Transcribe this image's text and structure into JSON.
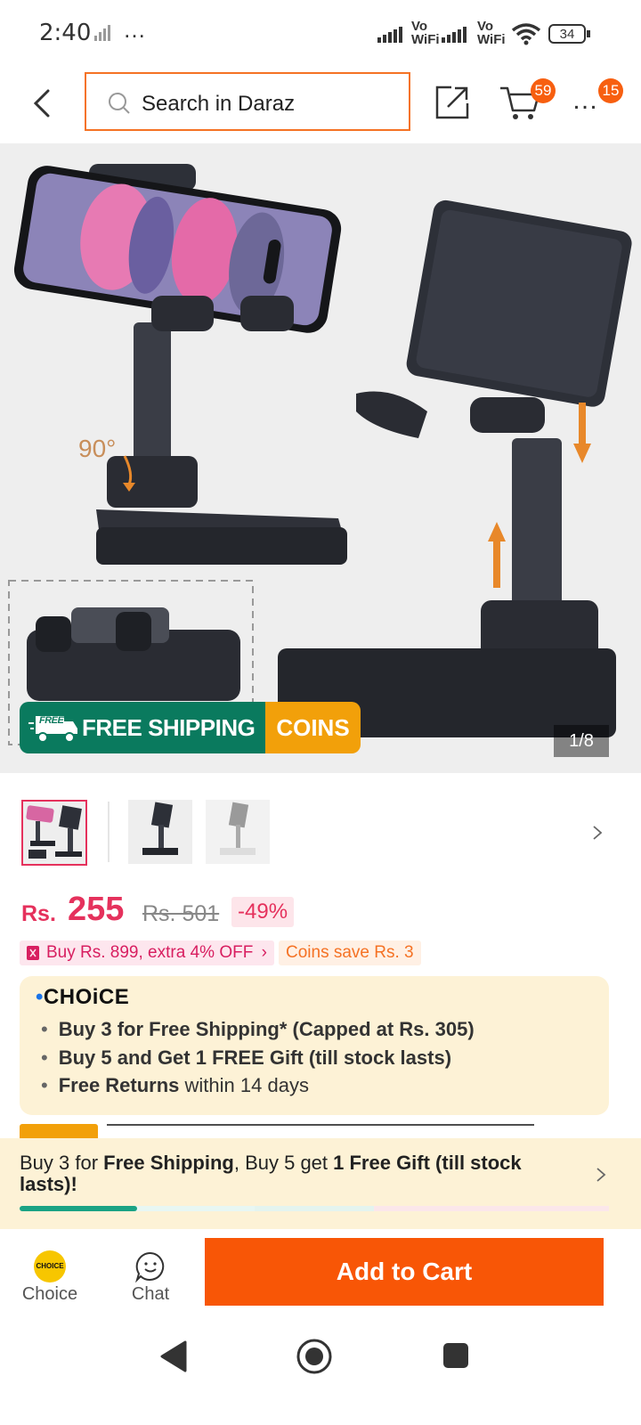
{
  "status_bar": {
    "time": "2:40",
    "dots": "…",
    "network_label_1": "Vo\nWiFi",
    "network_label_2": "Vo\nWiFi",
    "battery": "34"
  },
  "header": {
    "search_placeholder": "Search in Daraz",
    "cart_badge": "59",
    "more_badge": "15"
  },
  "gallery": {
    "angle_label": "90°",
    "free_shipping_label": "FREE SHIPPING",
    "free_tag": "FREE",
    "coins_label": "COINS",
    "counter": "1/8"
  },
  "price": {
    "currency": "Rs.",
    "current": "255",
    "original": "Rs. 501",
    "discount": "-49%"
  },
  "promos": {
    "voucher": "Buy Rs. 899, extra 4% OFF",
    "coins": "Coins save Rs. 3"
  },
  "choice": {
    "logo": "CHOiCE",
    "bullet1": "Buy 3 for  Free Shipping* (Capped at Rs. 305)",
    "bullet2": "Buy 5 and Get 1 FREE Gift (till stock lasts)",
    "bullet3_bold": "Free Returns",
    "bullet3_rest": " within 14 days"
  },
  "banner": {
    "part1": "Buy 3 for ",
    "part2": "Free Shipping",
    "part3": ", Buy 5 get ",
    "part4": "1 Free Gift (till stock lasts)!",
    "progress": 0.2
  },
  "action_bar": {
    "choice_badge": "CHOICE",
    "choice_label": "Choice",
    "chat_label": "Chat",
    "add_to_cart": "Add to Cart"
  },
  "colors": {
    "accent": "#f85606",
    "price": "#e5315c",
    "shipping_green": "#0a7a5e",
    "coins_yellow": "#f2a00a"
  }
}
